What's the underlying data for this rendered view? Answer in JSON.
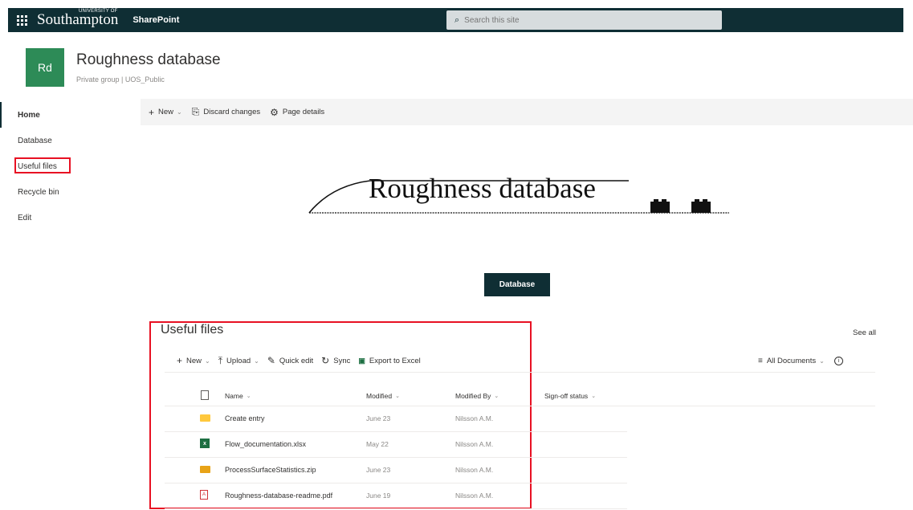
{
  "topbar": {
    "university_top": "UNIVERSITY OF",
    "university_name": "Southampton",
    "app_name": "SharePoint",
    "search_placeholder": "Search this site"
  },
  "site": {
    "logo_text": "Rd",
    "title": "Roughness database",
    "subtitle": "Private group | UOS_Public"
  },
  "nav": {
    "items": [
      {
        "label": "Home"
      },
      {
        "label": "Database"
      },
      {
        "label": "Useful files"
      },
      {
        "label": "Recycle bin"
      },
      {
        "label": "Edit"
      }
    ]
  },
  "commandbar": {
    "new_label": "New",
    "discard_label": "Discard changes",
    "page_details_label": "Page details"
  },
  "hero": {
    "text": "Roughness database"
  },
  "database_button": "Database",
  "useful_files": {
    "title": "Useful files",
    "see_all": "See all",
    "commands": {
      "new": "New",
      "upload": "Upload",
      "quick_edit": "Quick edit",
      "sync": "Sync",
      "export": "Export to Excel"
    },
    "view": "All Documents",
    "columns": {
      "name": "Name",
      "modified": "Modified",
      "modified_by": "Modified By",
      "signoff": "Sign-off status"
    },
    "files": [
      {
        "icon": "folder-icon",
        "name": "Create entry",
        "modified": "June 23",
        "modified_by": "Nilsson A.M."
      },
      {
        "icon": "excel-file-icon",
        "name": "Flow_documentation.xlsx",
        "modified": "May 22",
        "modified_by": "Nilsson A.M."
      },
      {
        "icon": "zip-folder-icon",
        "name": "ProcessSurfaceStatistics.zip",
        "modified": "June 23",
        "modified_by": "Nilsson A.M."
      },
      {
        "icon": "pdf-file-icon",
        "name": "Roughness-database-readme.pdf",
        "modified": "June 19",
        "modified_by": "Nilsson A.M."
      }
    ]
  },
  "colors": {
    "suite_bar": "#0f2e34",
    "site_logo": "#2d8b57",
    "highlight": "#e81123"
  }
}
